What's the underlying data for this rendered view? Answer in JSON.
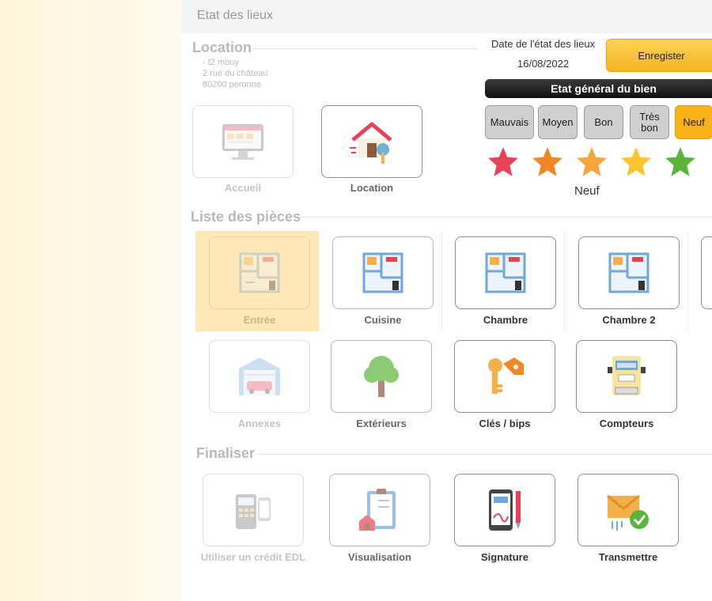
{
  "topbar": {
    "title": "Etat des lieux"
  },
  "location": {
    "section_title": "Location",
    "address_lines": [
      "- t2 mouy",
      "2 rue du château",
      "80200 peronne"
    ]
  },
  "nav_tiles": [
    {
      "label": "Accueil",
      "icon": "monitor-icon"
    },
    {
      "label": "Location",
      "icon": "house-key-icon"
    }
  ],
  "etat": {
    "date_label": "Date de l'état des lieux",
    "date_value": "16/08/2022",
    "save_label": "Enregister",
    "header": "Etat général du bien",
    "conditions": [
      {
        "label": "Mauvais",
        "active": false
      },
      {
        "label": "Moyen",
        "active": false
      },
      {
        "label": "Bon",
        "active": false
      },
      {
        "label": "Très bon",
        "active": false
      },
      {
        "label": "Neuf",
        "active": true
      }
    ],
    "stars": [
      {
        "icon": "star-icon",
        "color": "#e94256"
      },
      {
        "icon": "star-icon",
        "color": "#f08624"
      },
      {
        "icon": "star-icon",
        "color": "#f8a63a"
      },
      {
        "icon": "star-icon",
        "color": "#fbc32c"
      },
      {
        "icon": "star-icon",
        "color": "#5cb53a"
      }
    ],
    "selected_caption": "Neuf"
  },
  "rooms": {
    "section_title": "Liste des pièces",
    "items": [
      {
        "label": "Entrée",
        "icon": "floorplan-icon",
        "selected": true
      },
      {
        "label": "Cuisine",
        "icon": "floorplan-icon"
      },
      {
        "label": "Chambre",
        "icon": "floorplan-icon"
      },
      {
        "label": "Chambre 2",
        "icon": "floorplan-icon"
      }
    ]
  },
  "extras": [
    {
      "label": "Annexes",
      "icon": "garage-icon"
    },
    {
      "label": "Extérieurs",
      "icon": "tree-icon"
    },
    {
      "label": "Clés / bips",
      "icon": "keys-icon"
    },
    {
      "label": "Compteurs",
      "icon": "meter-icon"
    }
  ],
  "finalize": {
    "section_title": "Finaliser",
    "items": [
      {
        "label": "Utiliser un crédit EDL",
        "icon": "payment-terminal-icon"
      },
      {
        "label": "Visualisation",
        "icon": "clipboard-house-icon"
      },
      {
        "label": "Signature",
        "icon": "phone-signature-icon"
      },
      {
        "label": "Transmettre",
        "icon": "envelope-check-icon"
      }
    ]
  },
  "colors": {
    "accent": "#f9b318",
    "selected_bg": "#ffe8b8"
  }
}
